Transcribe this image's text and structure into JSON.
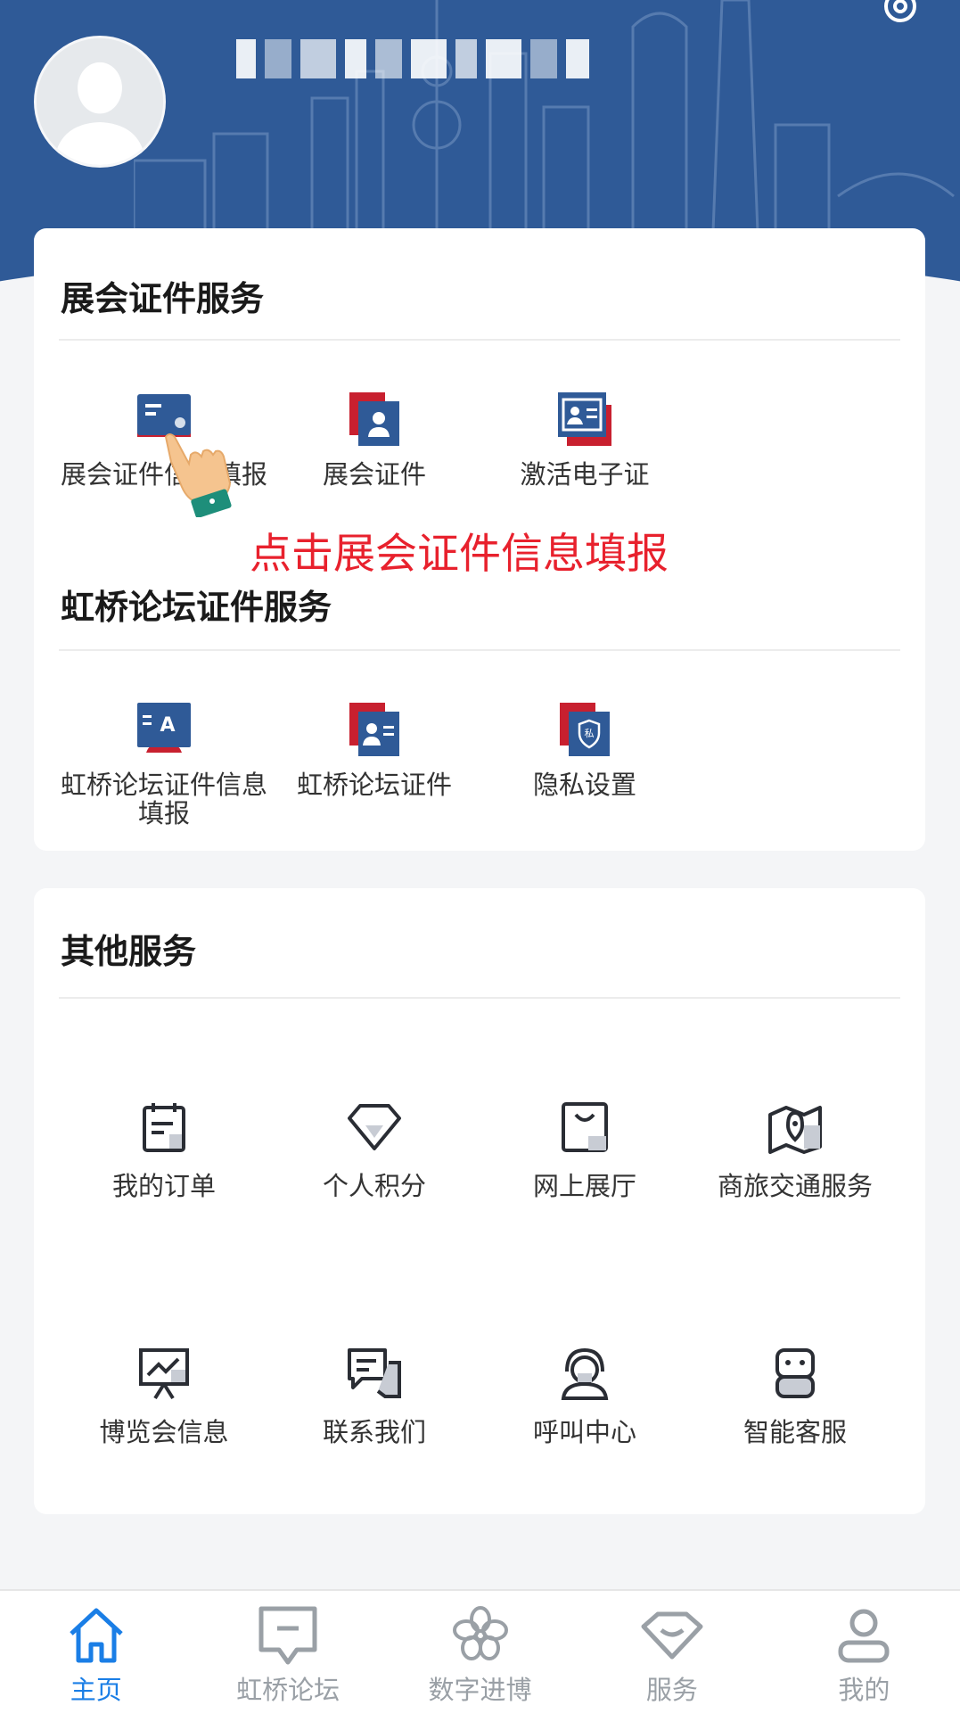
{
  "header": {
    "avatar": "avatar-placeholder",
    "username_masked": true,
    "settings_icon": "gear-icon",
    "colors": {
      "banner": "#2f5a97"
    }
  },
  "credential_services": {
    "title": "展会证件服务",
    "items": [
      {
        "label": "展会证件信息填报",
        "icon": "card-form-icon"
      },
      {
        "label": "展会证件",
        "icon": "person-badge-icon"
      },
      {
        "label": "激活电子证",
        "icon": "id-card-icon"
      }
    ]
  },
  "annotation": {
    "text": "点击展会证件信息填报",
    "color": "#e8212d",
    "pointer": "hand-pointer-icon"
  },
  "forum_services": {
    "title": "虹桥论坛证件服务",
    "items": [
      {
        "label": "虹桥论坛证件信息填报",
        "icon": "forum-card-icon"
      },
      {
        "label": "虹桥论坛证件",
        "icon": "forum-badge-icon"
      },
      {
        "label": "隐私设置",
        "icon": "privacy-shield-icon"
      }
    ]
  },
  "other_services": {
    "title": "其他服务",
    "items": [
      {
        "label": "我的订单",
        "icon": "clipboard-icon"
      },
      {
        "label": "个人积分",
        "icon": "diamond-icon"
      },
      {
        "label": "网上展厅",
        "icon": "shopping-bag-icon"
      },
      {
        "label": "商旅交通服务",
        "icon": "map-pin-icon"
      },
      {
        "label": "博览会信息",
        "icon": "presentation-icon"
      },
      {
        "label": "联系我们",
        "icon": "chat-icon"
      },
      {
        "label": "呼叫中心",
        "icon": "headset-icon"
      },
      {
        "label": "智能客服",
        "icon": "robot-icon"
      }
    ]
  },
  "bottom_nav": {
    "active_color": "#1a7ee6",
    "items": [
      {
        "label": "主页",
        "icon": "home-icon",
        "active": true
      },
      {
        "label": "虹桥论坛",
        "icon": "message-icon",
        "active": false
      },
      {
        "label": "数字进博",
        "icon": "flower-icon",
        "active": false
      },
      {
        "label": "服务",
        "icon": "diamond-icon",
        "active": false
      },
      {
        "label": "我的",
        "icon": "user-icon",
        "active": false
      }
    ]
  }
}
